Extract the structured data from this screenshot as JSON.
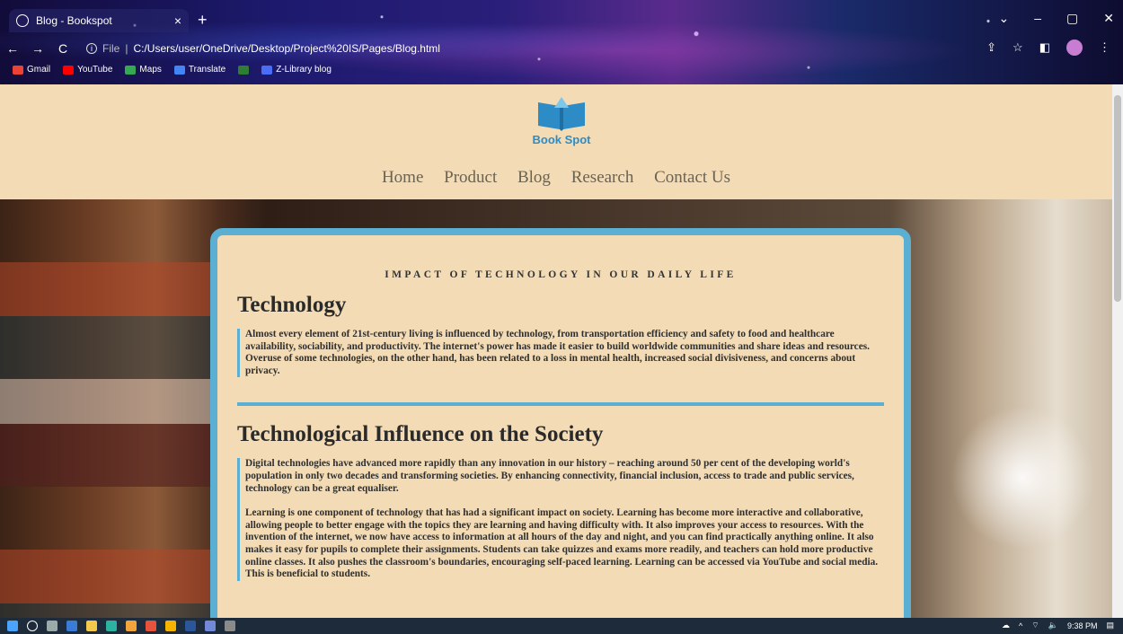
{
  "browser": {
    "tab_title": "Blog - Bookspot",
    "tab_close": "×",
    "new_tab": "+",
    "url_prefix": "File",
    "url": "C:/Users/user/OneDrive/Desktop/Project%20IS/Pages/Blog.html",
    "bookmarks": [
      {
        "label": "Gmail",
        "color": "#ea4335"
      },
      {
        "label": "YouTube",
        "color": "#ff0000"
      },
      {
        "label": "Maps",
        "color": "#34a853"
      },
      {
        "label": "Translate",
        "color": "#4285f4"
      },
      {
        "label": "",
        "color": "#2e7d32"
      },
      {
        "label": "Z-Library blog",
        "color": "#4a6cf7"
      }
    ]
  },
  "site": {
    "logo_text": "Book Spot",
    "nav": [
      "Home",
      "Product",
      "Blog",
      "Research",
      "Contact Us"
    ]
  },
  "article": {
    "kicker": "IMPACT OF TECHNOLOGY IN OUR DAILY LIFE",
    "section1_title": "Technology",
    "section1_text": "Almost every element of 21st-century living is influenced by technology, from transportation efficiency and safety to food and healthcare availability, sociability, and productivity. The internet's power has made it easier to build worldwide communities and share ideas and resources. Overuse of some technologies, on the other hand, has been related to a loss in mental health, increased social divisiveness, and concerns about privacy.",
    "section2_title": "Technological Influence on the Society",
    "section2_p1": "Digital technologies have advanced more rapidly than any innovation in our history – reaching around 50 per cent of the developing world's population in only two decades and transforming societies. By enhancing connectivity, financial inclusion, access to trade and public services, technology can be a great equaliser.",
    "section2_p2": "Learning is one component of technology that has had a significant impact on society. Learning has become more interactive and collaborative, allowing people to better engage with the topics they are learning and having difficulty with. It also improves your access to resources. With the invention of the internet, we now have access to information at all hours of the day and night, and you can find practically anything online. It also makes it easy for pupils to complete their assignments. Students can take quizzes and exams more readily, and teachers can hold more productive online classes. It also pushes the classroom's boundaries, encouraging self-paced learning. Learning can be accessed via YouTube and social media. This is beneficial to students."
  },
  "taskbar": {
    "time": "9:38 PM"
  },
  "colors": {
    "accent": "#5aafd2",
    "header_bg": "#f3dbb5"
  }
}
